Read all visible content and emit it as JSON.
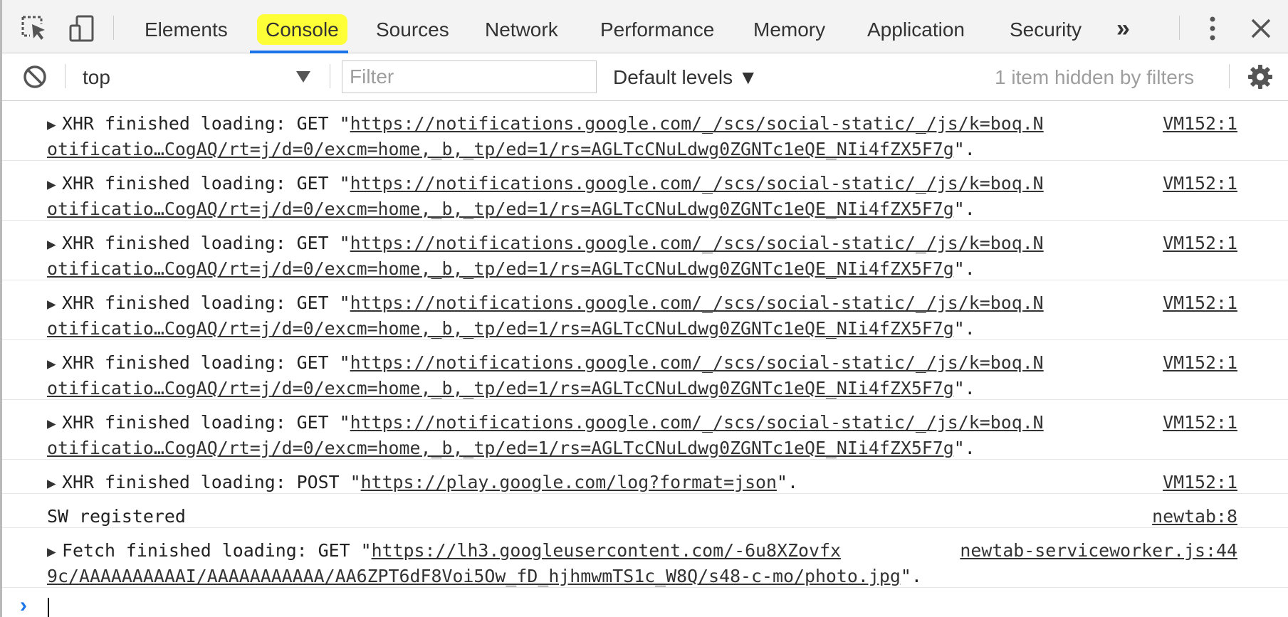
{
  "tabs": {
    "items": [
      {
        "label": "Elements"
      },
      {
        "label": "Console"
      },
      {
        "label": "Sources"
      },
      {
        "label": "Network"
      },
      {
        "label": "Performance"
      },
      {
        "label": "Memory"
      },
      {
        "label": "Application"
      },
      {
        "label": "Security"
      }
    ],
    "selected": "Console",
    "overflow_label": "»"
  },
  "toolbar": {
    "context": "top",
    "filter_placeholder": "Filter",
    "levels_label": "Default levels ▼",
    "hidden_text": "1 item hidden by filters"
  },
  "messages": [
    {
      "text_prefix": "XHR finished loading: GET \"",
      "url_line1": "https://notifications.google.com/_/scs/social-static/_/js/k=boq.N",
      "url_line2": "otificatio…CogAQ/rt=j/d=0/excm=home,_b,_tp/ed=1/rs=AGLTcCNuLdwg0ZGNTc1eQE_NIi4fZX5F7g",
      "suffix": "\".",
      "source": "VM152:1"
    },
    {
      "text_prefix": "XHR finished loading: GET \"",
      "url_line1": "https://notifications.google.com/_/scs/social-static/_/js/k=boq.N",
      "url_line2": "otificatio…CogAQ/rt=j/d=0/excm=home,_b,_tp/ed=1/rs=AGLTcCNuLdwg0ZGNTc1eQE_NIi4fZX5F7g",
      "suffix": "\".",
      "source": "VM152:1"
    },
    {
      "text_prefix": "XHR finished loading: GET \"",
      "url_line1": "https://notifications.google.com/_/scs/social-static/_/js/k=boq.N",
      "url_line2": "otificatio…CogAQ/rt=j/d=0/excm=home,_b,_tp/ed=1/rs=AGLTcCNuLdwg0ZGNTc1eQE_NIi4fZX5F7g",
      "suffix": "\".",
      "source": "VM152:1"
    },
    {
      "text_prefix": "XHR finished loading: GET \"",
      "url_line1": "https://notifications.google.com/_/scs/social-static/_/js/k=boq.N",
      "url_line2": "otificatio…CogAQ/rt=j/d=0/excm=home,_b,_tp/ed=1/rs=AGLTcCNuLdwg0ZGNTc1eQE_NIi4fZX5F7g",
      "suffix": "\".",
      "source": "VM152:1"
    },
    {
      "text_prefix": "XHR finished loading: GET \"",
      "url_line1": "https://notifications.google.com/_/scs/social-static/_/js/k=boq.N",
      "url_line2": "otificatio…CogAQ/rt=j/d=0/excm=home,_b,_tp/ed=1/rs=AGLTcCNuLdwg0ZGNTc1eQE_NIi4fZX5F7g",
      "suffix": "\".",
      "source": "VM152:1"
    },
    {
      "text_prefix": "XHR finished loading: GET \"",
      "url_line1": "https://notifications.google.com/_/scs/social-static/_/js/k=boq.N",
      "url_line2": "otificatio…CogAQ/rt=j/d=0/excm=home,_b,_tp/ed=1/rs=AGLTcCNuLdwg0ZGNTc1eQE_NIi4fZX5F7g",
      "suffix": "\".",
      "source": "VM152:1"
    },
    {
      "text_prefix": "XHR finished loading: POST \"",
      "url_line1": "https://play.google.com/log?format=json",
      "suffix": "\".",
      "source": "VM152:1"
    },
    {
      "text": "SW registered",
      "source": "newtab:8"
    },
    {
      "text_prefix": "Fetch finished loading: GET \"",
      "url_line1": "https://lh3.googleusercontent.com/-6u8XZovfx",
      "url_line2": "9c/AAAAAAAAAAI/AAAAAAAAAAA/AA6ZPT6dF8Voi5Ow_fD_hjhmwmTS1c_W8Q/s48-c-mo/photo.jpg",
      "suffix": "\".",
      "source": "newtab-serviceworker.js:44"
    }
  ],
  "prompt": {
    "symbol": "›"
  },
  "colors": {
    "accent": "#1a73e8",
    "highlight": "#ffff38",
    "toolbar_bg": "#f3f3f3"
  }
}
